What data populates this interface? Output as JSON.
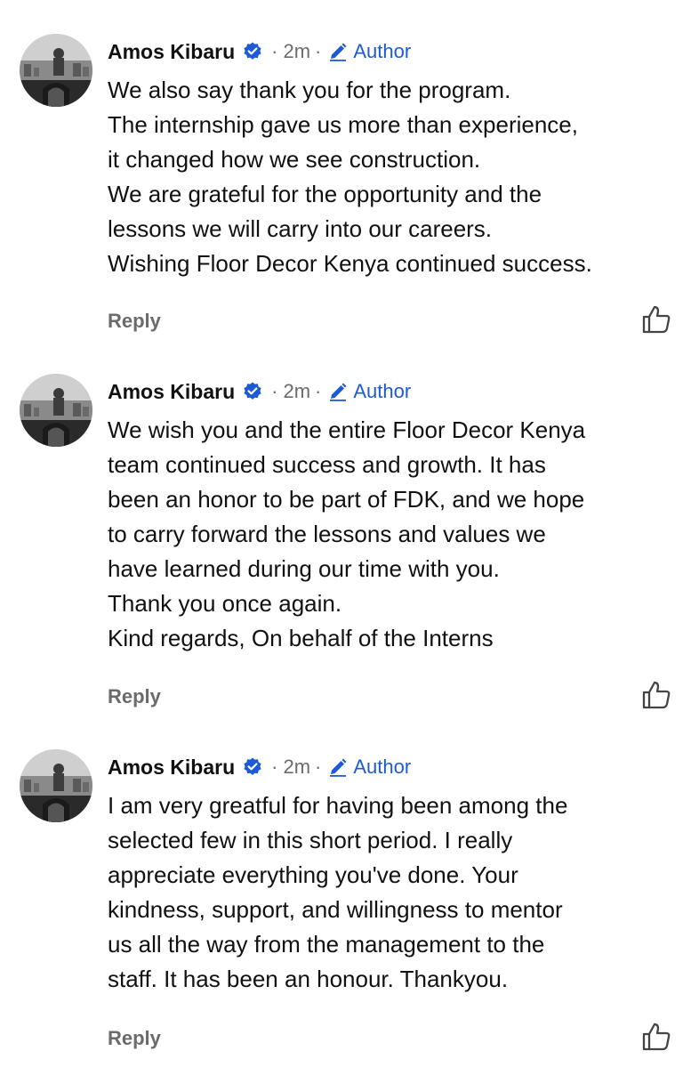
{
  "comments": [
    {
      "author": "Amos Kibaru",
      "time": "2m",
      "badge": "Author",
      "lines": [
        "We also say thank you for the program.",
        "The internship gave us more than experience,",
        "it changed how we see construction.",
        "We are grateful for the opportunity and the",
        "lessons we will carry into our careers.",
        "Wishing Floor Decor Kenya continued success."
      ],
      "reply_label": "Reply"
    },
    {
      "author": "Amos Kibaru",
      "time": "2m",
      "badge": "Author",
      "lines": [
        "We wish you and the entire Floor Decor Kenya",
        "team continued success and growth. It has",
        "been an honor to be part of FDK, and we hope",
        "to carry forward the lessons and values we",
        "have learned during our time with you.",
        "Thank you once again.",
        "Kind regards, On behalf of the Interns"
      ],
      "reply_label": "Reply"
    },
    {
      "author": "Amos Kibaru",
      "time": "2m",
      "badge": "Author",
      "lines": [
        "I am very greatful for having been among the",
        "selected few in this short period. I really",
        "appreciate everything you've done. Your",
        "kindness, support, and willingness to mentor",
        "us all the way from the management to the",
        "staff. It has been an honour. Thankyou."
      ],
      "reply_label": "Reply"
    }
  ],
  "separator": "·",
  "icons": {
    "verified": "verified-badge-icon",
    "edit": "pencil-icon",
    "like": "thumbs-up-icon"
  },
  "colors": {
    "accent": "#1d5ad6",
    "muted": "#6b6b6b",
    "text": "#111111"
  }
}
